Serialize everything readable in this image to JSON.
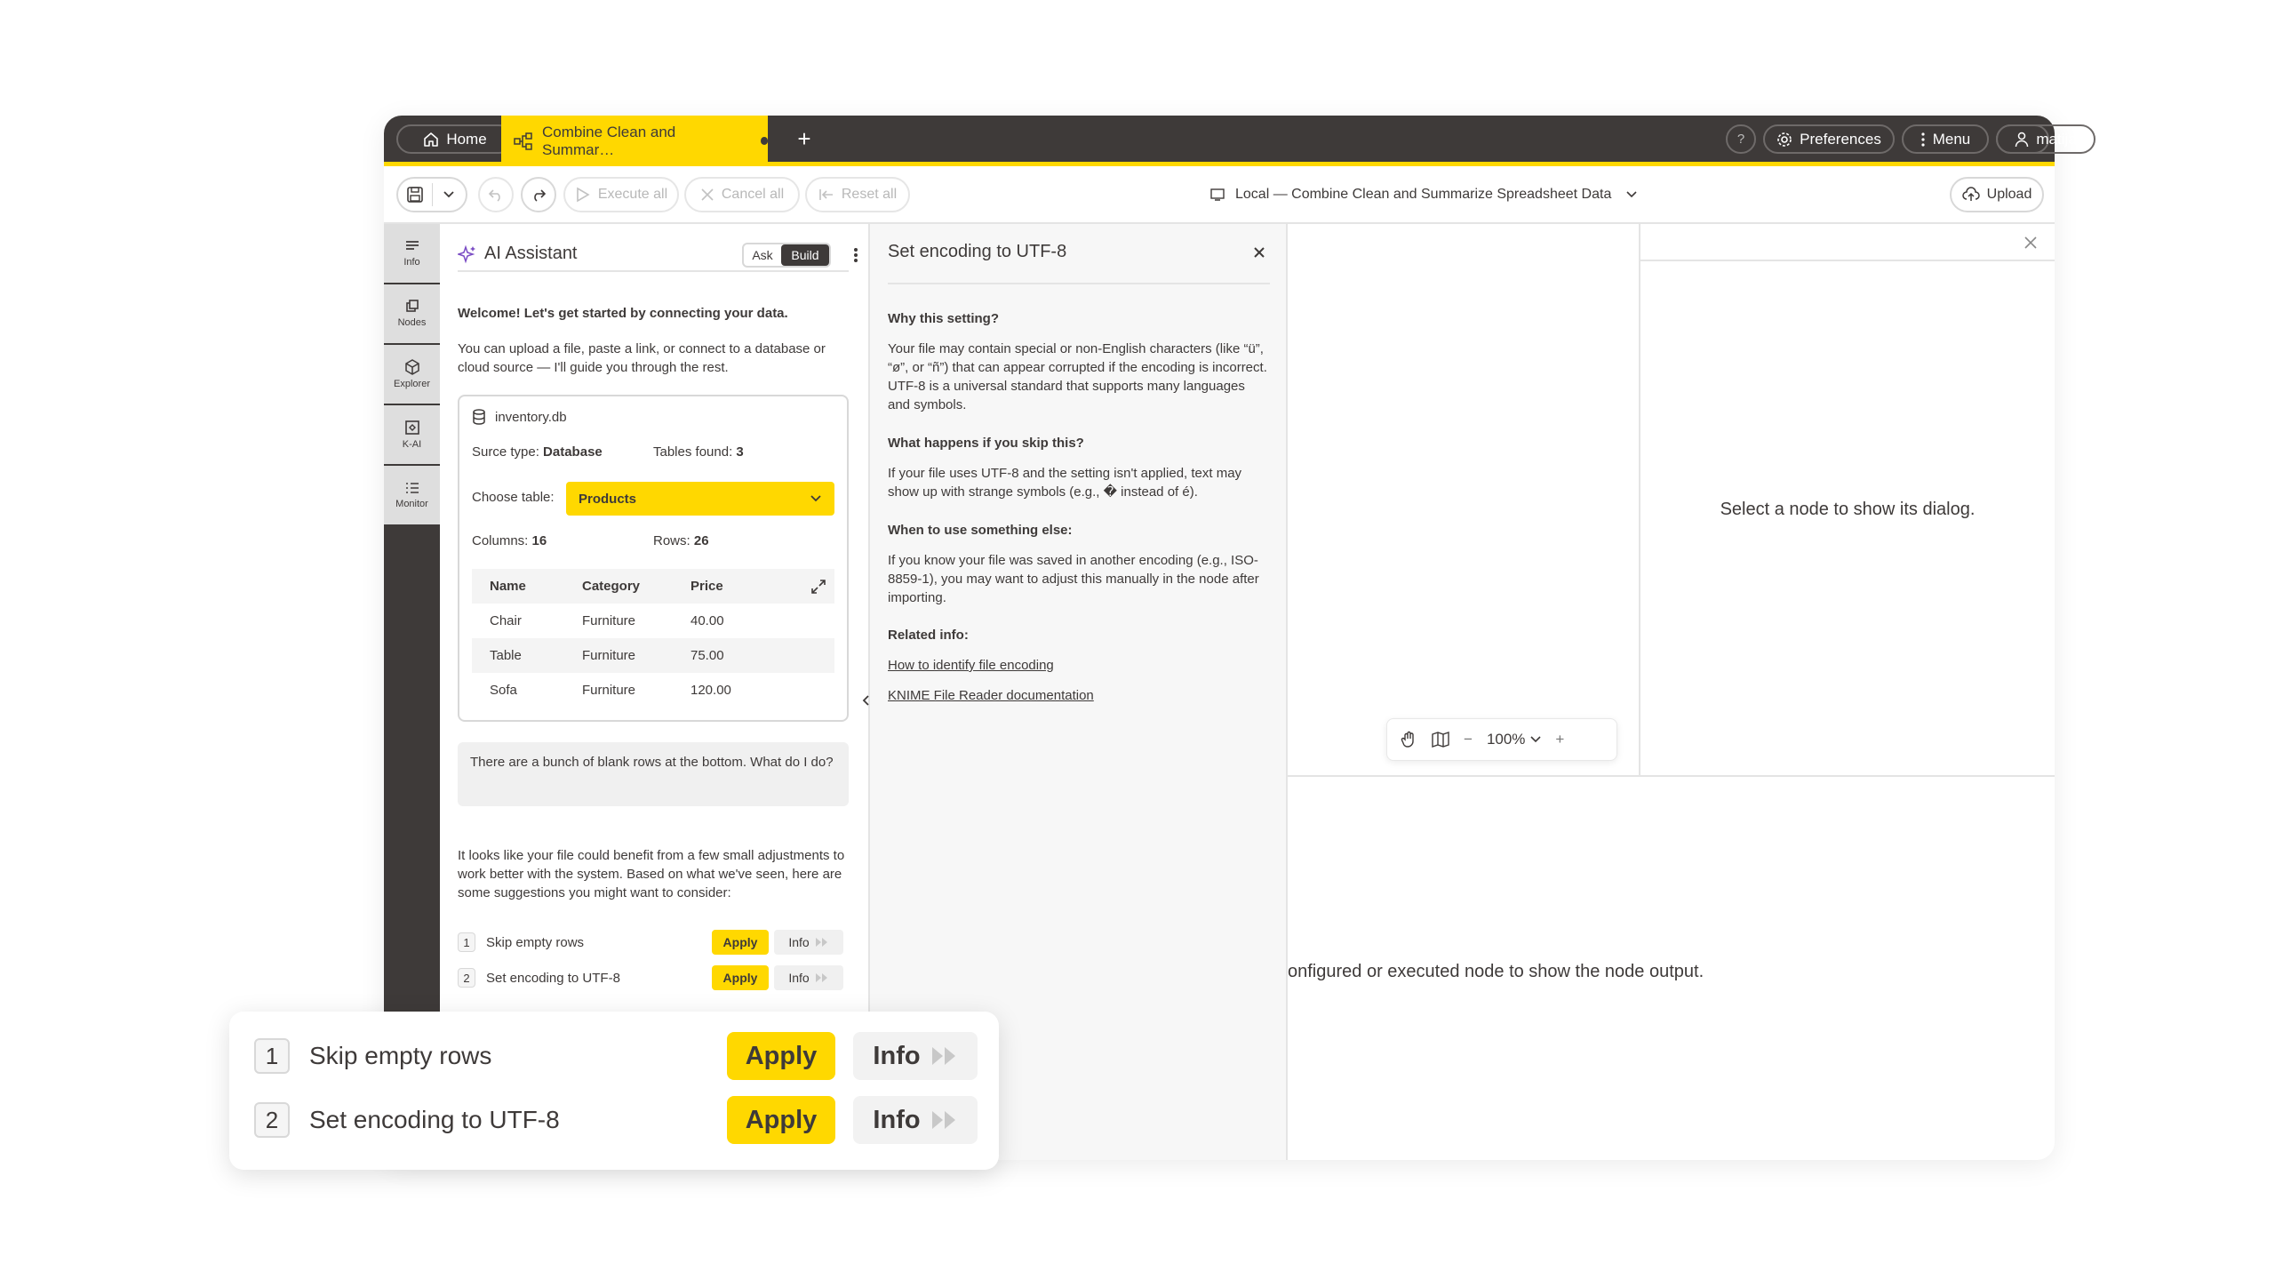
{
  "tabs": {
    "home_label": "Home",
    "workflow_label": "Combine Clean and Summar…",
    "add_tab": "+"
  },
  "header": {
    "help": "?",
    "preferences": "Preferences",
    "menu": "Menu",
    "user": "matija"
  },
  "toolbar": {
    "execute_all": "Execute all",
    "cancel_all": "Cancel all",
    "reset_all": "Reset all",
    "workflow_title": "Local — Combine Clean and Summarize Spreadsheet Data",
    "upload": "Upload"
  },
  "rail": {
    "items": [
      {
        "label": "Info",
        "icon": "info-icon"
      },
      {
        "label": "Nodes",
        "icon": "nodes-icon"
      },
      {
        "label": "Explorer",
        "icon": "explorer-icon"
      },
      {
        "label": "K-AI",
        "icon": "k-ai-icon"
      },
      {
        "label": "Monitor",
        "icon": "monitor-icon"
      }
    ]
  },
  "ai": {
    "title": "AI Assistant",
    "mode_ask": "Ask",
    "mode_build": "Build",
    "welcome": "Welcome! Let's get started by connecting your data.",
    "intro": "You can upload a file, paste a link, or connect to a database or cloud source — I'll guide you through the rest.",
    "card": {
      "file": "inventory.db",
      "source_label": "Surce type:",
      "source_value": "Database",
      "tables_label": "Tables found:",
      "tables_value": "3",
      "choose_label": "Choose table:",
      "choose_value": "Products",
      "columns_label": "Columns:",
      "columns_value": "16",
      "rows_label": "Rows:",
      "rows_value": "26",
      "table": {
        "headers": [
          "Name",
          "Category",
          "Price"
        ],
        "rows": [
          [
            "Chair",
            "Furniture",
            "40.00"
          ],
          [
            "Table",
            "Furniture",
            "75.00"
          ],
          [
            "Sofa",
            "Furniture",
            "120.00"
          ]
        ]
      }
    },
    "user_message": "There are a bunch of blank rows at the bottom. What do I do?",
    "response": "It looks like your file could benefit from a few small adjustments to work better with the system. Based on what we've seen, here are some suggestions you might want to consider:",
    "suggestions": [
      {
        "num": "1",
        "text": "Skip empty rows",
        "apply": "Apply",
        "info": "Info"
      },
      {
        "num": "2",
        "text": "Set encoding to UTF-8",
        "apply": "Apply",
        "info": "Info"
      }
    ]
  },
  "info_panel": {
    "title": "Set encoding to UTF-8",
    "why_h": "Why this setting?",
    "why_p": "Your file may contain special or non-English characters (like “ü”, “ø”, or “ñ”) that can appear corrupted if the encoding is incorrect. UTF-8 is a universal standard that supports many languages and symbols.",
    "skip_h": "What happens if you skip this?",
    "skip_p": "If your file uses UTF-8 and the setting isn't applied, text may show up with strange symbols (e.g., � instead of é).",
    "else_h": "When to use something else:",
    "else_p": "If you know your file was saved in another encoding (e.g., ISO-8859-1), you may want to adjust this manually in the node after importing.",
    "related_h": "Related info:",
    "link1": "How to identify file encoding",
    "link2": "KNIME File Reader documentation"
  },
  "canvas": {
    "zoom": "100%"
  },
  "dialog": {
    "message": "Select a node to show its dialog."
  },
  "output": {
    "message": "onfigured or executed node to show the node output."
  },
  "colors": {
    "accent": "#ffd800",
    "dark": "#3e3a39"
  }
}
